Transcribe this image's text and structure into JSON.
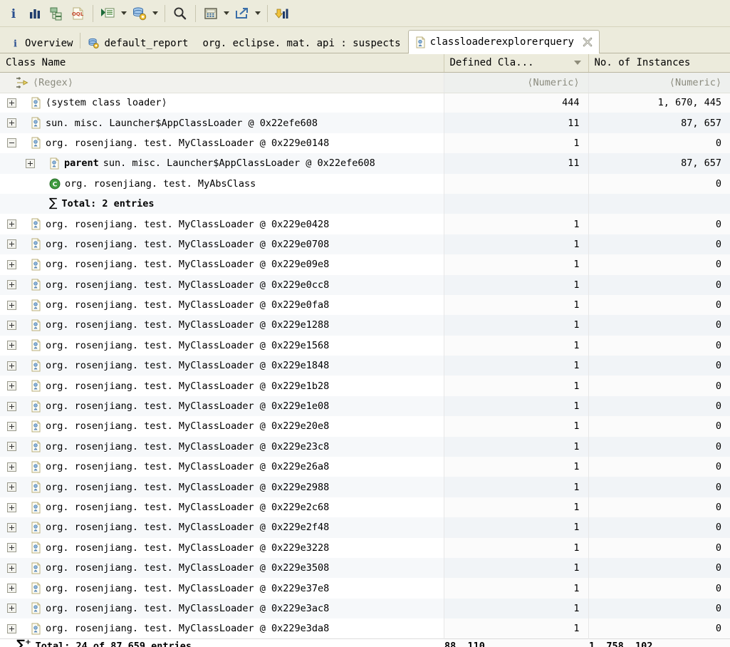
{
  "toolbar": {
    "items": [
      {
        "name": "info-icon",
        "label": "i"
      },
      {
        "name": "histogram-icon",
        "label": "Histogram"
      },
      {
        "name": "dominator-tree-icon",
        "label": "Dominator Tree"
      },
      {
        "name": "oql-icon",
        "label": "OQL"
      },
      {
        "name": "separator-1",
        "label": ""
      },
      {
        "name": "run-expert-system-test-icon",
        "label": "Run Expert System Test"
      },
      {
        "name": "run-expert-system-dropdown-icon",
        "label": ""
      },
      {
        "name": "query-browser-icon",
        "label": "Query Browser"
      },
      {
        "name": "query-browser-dropdown-icon",
        "label": ""
      },
      {
        "name": "separator-2",
        "label": ""
      },
      {
        "name": "search-icon",
        "label": "Find"
      },
      {
        "name": "separator-3",
        "label": ""
      },
      {
        "name": "calculator-icon",
        "label": "Calculate Retained Size"
      },
      {
        "name": "calculator-dropdown-icon",
        "label": ""
      },
      {
        "name": "export-icon",
        "label": "Export"
      },
      {
        "name": "export-dropdown-icon",
        "label": ""
      },
      {
        "name": "separator-4",
        "label": ""
      },
      {
        "name": "compare-icon",
        "label": "Compare"
      }
    ]
  },
  "tabs": [
    {
      "label": "Overview",
      "icon": "info-icon",
      "active": false
    },
    {
      "label": "default_report",
      "icon": "report-icon",
      "active": false
    },
    {
      "label": "org. eclipse. mat. api : suspects",
      "icon": "",
      "active": false
    },
    {
      "label": "classloaderexplorerquery",
      "icon": "classloader-icon",
      "active": true,
      "closable": true
    }
  ],
  "table": {
    "columns": [
      {
        "label": "Class Name",
        "align": "left",
        "sorted": false
      },
      {
        "label": "Defined Cla...",
        "align": "left",
        "sorted": true,
        "sort_dir": "desc"
      },
      {
        "label": "No. of Instances",
        "align": "left",
        "sorted": false
      }
    ],
    "filter_row": {
      "class_name": "⟨Regex⟩",
      "defined_classes": "⟨Numeric⟩",
      "instances": "⟨Numeric⟩"
    },
    "rows": [
      {
        "name": "⟨system class loader⟩",
        "defined": "444",
        "instances": "1, 670, 445",
        "twisty": "plus",
        "icon": "classloader-icon",
        "depth": 0,
        "bold_prefix": ""
      },
      {
        "name": "sun. misc. Launcher$AppClassLoader @ 0x22efe608",
        "defined": "11",
        "instances": "87, 657",
        "twisty": "plus",
        "icon": "classloader-icon",
        "depth": 0,
        "bold_prefix": ""
      },
      {
        "name": "org. rosenjiang. test. MyClassLoader @ 0x229e0148",
        "defined": "1",
        "instances": "0",
        "twisty": "minus",
        "icon": "classloader-icon",
        "depth": 0,
        "bold_prefix": ""
      },
      {
        "name": "sun. misc. Launcher$AppClassLoader @ 0x22efe608",
        "defined": "11",
        "instances": "87, 657",
        "twisty": "plus",
        "icon": "classloader-icon",
        "depth": 1,
        "bold_prefix": "parent"
      },
      {
        "name": "org. rosenjiang. test. MyAbsClass",
        "defined": "",
        "instances": "0",
        "twisty": "none",
        "icon": "class-icon",
        "depth": 1,
        "bold_prefix": ""
      },
      {
        "name": "Total: 2 entries",
        "defined": "",
        "instances": "",
        "twisty": "none",
        "icon": "sigma-icon",
        "depth": 1,
        "bold_prefix": "",
        "is_subtotal": true
      },
      {
        "name": "org. rosenjiang. test. MyClassLoader @ 0x229e0428",
        "defined": "1",
        "instances": "0",
        "twisty": "plus",
        "icon": "classloader-icon",
        "depth": 0,
        "bold_prefix": ""
      },
      {
        "name": "org. rosenjiang. test. MyClassLoader @ 0x229e0708",
        "defined": "1",
        "instances": "0",
        "twisty": "plus",
        "icon": "classloader-icon",
        "depth": 0,
        "bold_prefix": ""
      },
      {
        "name": "org. rosenjiang. test. MyClassLoader @ 0x229e09e8",
        "defined": "1",
        "instances": "0",
        "twisty": "plus",
        "icon": "classloader-icon",
        "depth": 0,
        "bold_prefix": ""
      },
      {
        "name": "org. rosenjiang. test. MyClassLoader @ 0x229e0cc8",
        "defined": "1",
        "instances": "0",
        "twisty": "plus",
        "icon": "classloader-icon",
        "depth": 0,
        "bold_prefix": ""
      },
      {
        "name": "org. rosenjiang. test. MyClassLoader @ 0x229e0fa8",
        "defined": "1",
        "instances": "0",
        "twisty": "plus",
        "icon": "classloader-icon",
        "depth": 0,
        "bold_prefix": ""
      },
      {
        "name": "org. rosenjiang. test. MyClassLoader @ 0x229e1288",
        "defined": "1",
        "instances": "0",
        "twisty": "plus",
        "icon": "classloader-icon",
        "depth": 0,
        "bold_prefix": ""
      },
      {
        "name": "org. rosenjiang. test. MyClassLoader @ 0x229e1568",
        "defined": "1",
        "instances": "0",
        "twisty": "plus",
        "icon": "classloader-icon",
        "depth": 0,
        "bold_prefix": ""
      },
      {
        "name": "org. rosenjiang. test. MyClassLoader @ 0x229e1848",
        "defined": "1",
        "instances": "0",
        "twisty": "plus",
        "icon": "classloader-icon",
        "depth": 0,
        "bold_prefix": ""
      },
      {
        "name": "org. rosenjiang. test. MyClassLoader @ 0x229e1b28",
        "defined": "1",
        "instances": "0",
        "twisty": "plus",
        "icon": "classloader-icon",
        "depth": 0,
        "bold_prefix": ""
      },
      {
        "name": "org. rosenjiang. test. MyClassLoader @ 0x229e1e08",
        "defined": "1",
        "instances": "0",
        "twisty": "plus",
        "icon": "classloader-icon",
        "depth": 0,
        "bold_prefix": ""
      },
      {
        "name": "org. rosenjiang. test. MyClassLoader @ 0x229e20e8",
        "defined": "1",
        "instances": "0",
        "twisty": "plus",
        "icon": "classloader-icon",
        "depth": 0,
        "bold_prefix": ""
      },
      {
        "name": "org. rosenjiang. test. MyClassLoader @ 0x229e23c8",
        "defined": "1",
        "instances": "0",
        "twisty": "plus",
        "icon": "classloader-icon",
        "depth": 0,
        "bold_prefix": ""
      },
      {
        "name": "org. rosenjiang. test. MyClassLoader @ 0x229e26a8",
        "defined": "1",
        "instances": "0",
        "twisty": "plus",
        "icon": "classloader-icon",
        "depth": 0,
        "bold_prefix": ""
      },
      {
        "name": "org. rosenjiang. test. MyClassLoader @ 0x229e2988",
        "defined": "1",
        "instances": "0",
        "twisty": "plus",
        "icon": "classloader-icon",
        "depth": 0,
        "bold_prefix": ""
      },
      {
        "name": "org. rosenjiang. test. MyClassLoader @ 0x229e2c68",
        "defined": "1",
        "instances": "0",
        "twisty": "plus",
        "icon": "classloader-icon",
        "depth": 0,
        "bold_prefix": ""
      },
      {
        "name": "org. rosenjiang. test. MyClassLoader @ 0x229e2f48",
        "defined": "1",
        "instances": "0",
        "twisty": "plus",
        "icon": "classloader-icon",
        "depth": 0,
        "bold_prefix": ""
      },
      {
        "name": "org. rosenjiang. test. MyClassLoader @ 0x229e3228",
        "defined": "1",
        "instances": "0",
        "twisty": "plus",
        "icon": "classloader-icon",
        "depth": 0,
        "bold_prefix": ""
      },
      {
        "name": "org. rosenjiang. test. MyClassLoader @ 0x229e3508",
        "defined": "1",
        "instances": "0",
        "twisty": "plus",
        "icon": "classloader-icon",
        "depth": 0,
        "bold_prefix": ""
      },
      {
        "name": "org. rosenjiang. test. MyClassLoader @ 0x229e37e8",
        "defined": "1",
        "instances": "0",
        "twisty": "plus",
        "icon": "classloader-icon",
        "depth": 0,
        "bold_prefix": ""
      },
      {
        "name": "org. rosenjiang. test. MyClassLoader @ 0x229e3ac8",
        "defined": "1",
        "instances": "0",
        "twisty": "plus",
        "icon": "classloader-icon",
        "depth": 0,
        "bold_prefix": ""
      },
      {
        "name": "org. rosenjiang. test. MyClassLoader @ 0x229e3da8",
        "defined": "1",
        "instances": "0",
        "twisty": "plus",
        "icon": "classloader-icon",
        "depth": 0,
        "bold_prefix": ""
      }
    ],
    "total_row": {
      "label": "Total: 24 of 87,659 entries",
      "defined": "88, 110",
      "instances": "1, 758, 102",
      "icon": "sigma-plus-icon"
    }
  },
  "colors": {
    "toolbar_bg": "#ecebdc",
    "tab_active_bg": "#ffffff",
    "header_bg": "#ecebdc",
    "row_alt_bg": "#f6f8fa",
    "numeric_col_bg": "#f1f4f7",
    "text": "#000000",
    "filter_text": "#8a8a7d"
  }
}
